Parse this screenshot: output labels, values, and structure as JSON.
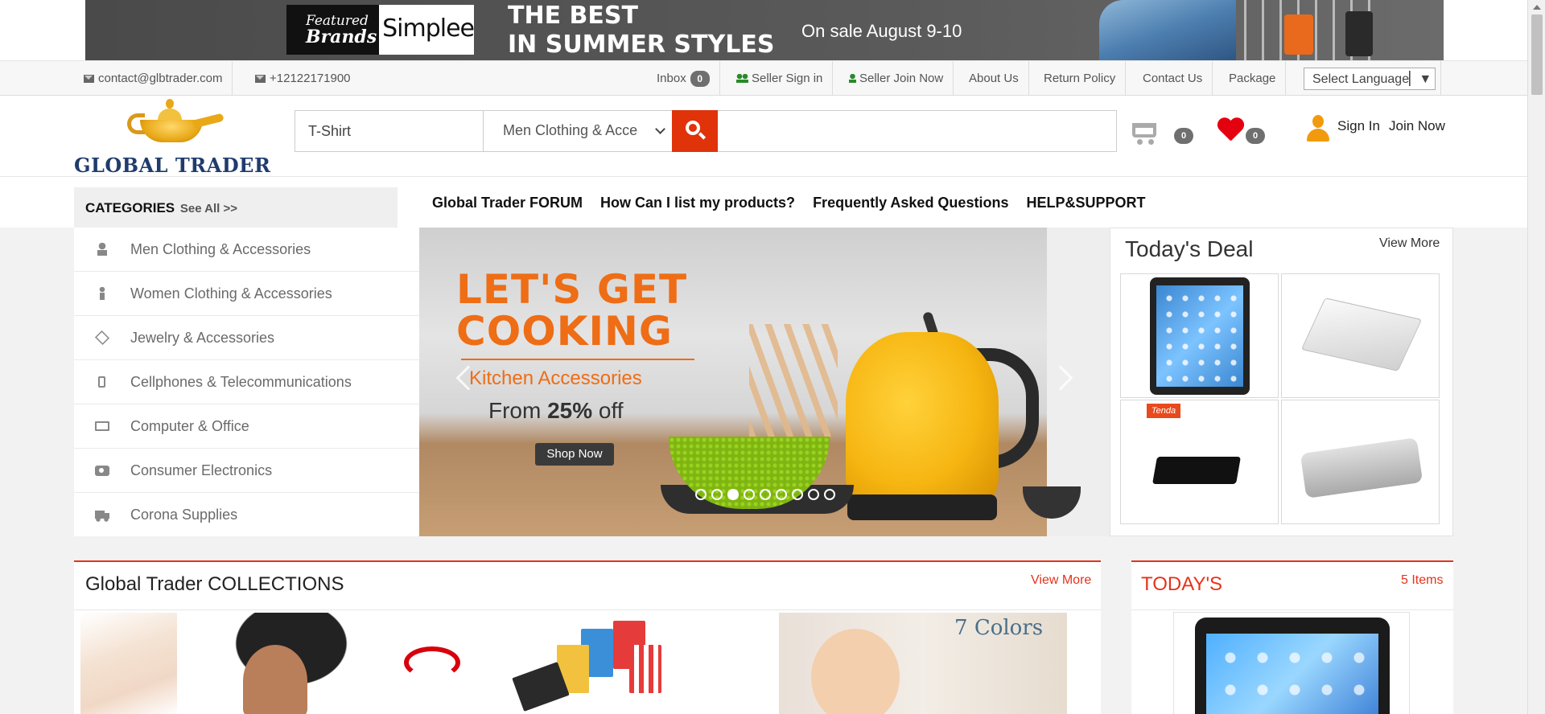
{
  "promo_banner": {
    "brand_left_line1": "Featured",
    "brand_left_line2": "Brands",
    "brand_right": "Simplee",
    "headline_line1": "THE BEST",
    "headline_line2": "IN SUMMER STYLES",
    "sale_text": "On sale August 9-10"
  },
  "infobar": {
    "email": "contact@glbtrader.com",
    "phone": "+12122171900",
    "inbox_label": "Inbox",
    "inbox_count": "0",
    "seller_signin": "Seller Sign in",
    "seller_join": "Seller Join Now",
    "about": "About Us",
    "return_policy": "Return Policy",
    "contact": "Contact Us",
    "package": "Package",
    "language_select": "Select Language▏▼"
  },
  "header": {
    "logo_text": "GLOBAL TRADER",
    "search_value": "T-Shirt",
    "search_category": "Men Clothing & Acce",
    "cart_count": "0",
    "wishlist_count": "0",
    "sign_in": "Sign In",
    "join_now": "Join Now"
  },
  "categories": {
    "title": "CATEGORIES",
    "see_all": "See All >>",
    "items": [
      {
        "label": "Men Clothing & Accessories",
        "icon": "user-icon"
      },
      {
        "label": "Women Clothing & Accessories",
        "icon": "female-icon"
      },
      {
        "label": "Jewelry & Accessories",
        "icon": "diamond-icon"
      },
      {
        "label": "Cellphones & Telecommunications",
        "icon": "mobile-phone-icon"
      },
      {
        "label": "Computer & Office",
        "icon": "desktop-icon"
      },
      {
        "label": "Consumer Electronics",
        "icon": "camera-icon"
      },
      {
        "label": "Corona Supplies",
        "icon": "ambulance-icon"
      }
    ]
  },
  "main_nav": [
    "Global Trader FORUM",
    "How Can I list my products?",
    "Frequently Asked Questions",
    "HELP&SUPPORT"
  ],
  "hero": {
    "line1": "LET'S GET",
    "line2": "COOKING",
    "subtitle": "Kitchen Accessories",
    "offer_prefix": "From ",
    "offer_value": "25%",
    "offer_suffix": " off",
    "button": "Shop Now",
    "slide_count": 9,
    "active_slide": 3
  },
  "todays_deal": {
    "title": "Today's Deal",
    "view_more": "View More",
    "products": [
      "tablet",
      "network-switch",
      "router",
      "speaker"
    ],
    "tenda_label": "Tenda"
  },
  "collections": {
    "title": "Global Trader COLLECTIONS",
    "view_more": "View More",
    "colors_label": "Colors",
    "colors_number": "7"
  },
  "todays_panel": {
    "title": "TODAY'S",
    "items": "5 Items"
  },
  "colors": {
    "accent_red": "#e6321a",
    "search_button": "#e0330a",
    "hero_orange": "#ee6d15",
    "logo_blue": "#1f3c6e"
  }
}
